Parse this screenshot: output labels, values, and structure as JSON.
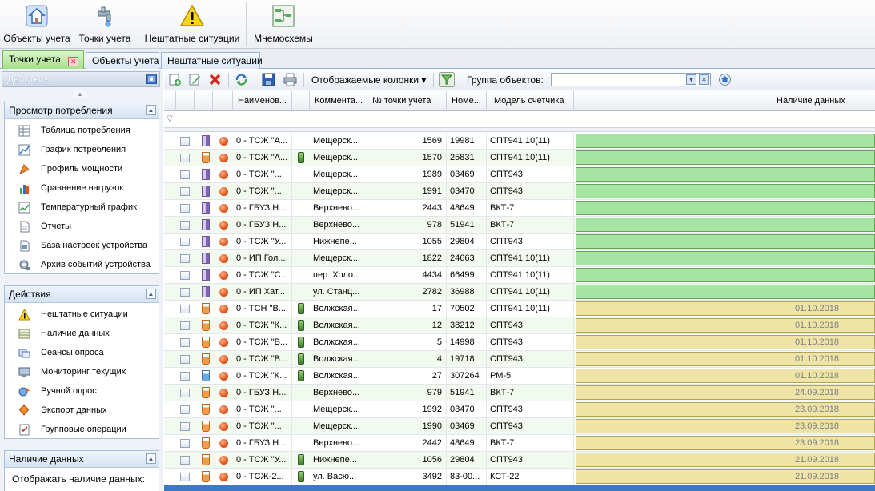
{
  "ribbon": {
    "buttons": [
      {
        "label": "Объекты учета",
        "icon": "house-icon"
      },
      {
        "label": "Точки учета",
        "icon": "faucet-icon"
      },
      {
        "label": "Нештатные ситуации",
        "icon": "warning-icon"
      },
      {
        "label": "Мнемосхемы",
        "icon": "diagram-icon"
      }
    ]
  },
  "tabs": [
    {
      "label": "Точки учета",
      "active": true
    },
    {
      "label": "Объекты учета",
      "active": false
    },
    {
      "label": "Нештатные ситуации",
      "active": false
    }
  ],
  "left_panel": {
    "title": "Действия",
    "groups": [
      {
        "title": "Просмотр потребления",
        "items": [
          "Таблица потребления",
          "График потребления",
          "Профиль мощности",
          "Сравнение нагрузок",
          "Температурный график",
          "Отчеты",
          "База настроек устройства",
          "Архив событий устройства"
        ]
      },
      {
        "title": "Действия",
        "items": [
          "Нештатные ситуации",
          "Наличие данных",
          "Сеансы опроса",
          "Мониторинг текущих",
          "Ручной опрос",
          "Экспорт данных",
          "Групповые операции"
        ]
      },
      {
        "title": "Наличие данных",
        "items": [
          "Отображать наличие данных:"
        ]
      }
    ]
  },
  "toolbar": {
    "columns_label": "Отображаемые колонки",
    "group_label": "Группа объектов:",
    "group_value": ""
  },
  "grid": {
    "columns": [
      "Наименов...",
      "Коммента...",
      "№ точки учета",
      "Номе...",
      "Модель счетчика",
      "Наличие данных"
    ],
    "rows": [
      {
        "meter": "heat",
        "device": false,
        "name": "0 - ТСЖ \"А...",
        "comment": "Мещерск...",
        "point": "1569",
        "num": "19981",
        "model": "СПТ941.10(11)",
        "avail": "green",
        "date": ""
      },
      {
        "meter": "water",
        "device": true,
        "name": "0 - ТСЖ \"А...",
        "comment": "Мещерск...",
        "point": "1570",
        "num": "25831",
        "model": "СПТ941.10(11)",
        "avail": "green",
        "date": ""
      },
      {
        "meter": "heat",
        "device": false,
        "name": "0 - ТСЖ \"...",
        "comment": "Мещерск...",
        "point": "1989",
        "num": "03469",
        "model": "СПТ943",
        "avail": "green",
        "date": ""
      },
      {
        "meter": "heat",
        "device": false,
        "name": "0 - ТСЖ \"...",
        "comment": "Мещерск...",
        "point": "1991",
        "num": "03470",
        "model": "СПТ943",
        "avail": "green",
        "date": ""
      },
      {
        "meter": "heat",
        "device": false,
        "name": "0 - ГБУЗ Н...",
        "comment": "Верхнево...",
        "point": "2443",
        "num": "48649",
        "model": "ВКТ-7",
        "avail": "green",
        "date": ""
      },
      {
        "meter": "heat",
        "device": false,
        "name": "0 - ГБУЗ Н...",
        "comment": "Верхнево...",
        "point": "978",
        "num": "51941",
        "model": "ВКТ-7",
        "avail": "green",
        "date": ""
      },
      {
        "meter": "heat",
        "device": false,
        "name": "0 - ТСЖ \"У...",
        "comment": "Нижнепе...",
        "point": "1055",
        "num": "29804",
        "model": "СПТ943",
        "avail": "green",
        "date": ""
      },
      {
        "meter": "heat",
        "device": false,
        "name": "0 - ИП Гол...",
        "comment": "Мещерск...",
        "point": "1822",
        "num": "24663",
        "model": "СПТ941.10(11)",
        "avail": "green",
        "date": ""
      },
      {
        "meter": "heat",
        "device": false,
        "name": "0 - ТСЖ \"С...",
        "comment": "пер. Холо...",
        "point": "4434",
        "num": "66499",
        "model": "СПТ941.10(11)",
        "avail": "green",
        "date": ""
      },
      {
        "meter": "heat",
        "device": false,
        "name": "0 - ИП Хат...",
        "comment": "ул. Станц...",
        "point": "2782",
        "num": "36988",
        "model": "СПТ941.10(11)",
        "avail": "green",
        "date": ""
      },
      {
        "meter": "water",
        "device": true,
        "name": "0 - ТСН \"В...",
        "comment": "Волжская...",
        "point": "17",
        "num": "70502",
        "model": "СПТ941.10(11)",
        "avail": "yellow",
        "date": "01.10.2018"
      },
      {
        "meter": "water",
        "device": true,
        "name": "0 - ТСЖ \"К...",
        "comment": "Волжская...",
        "point": "12",
        "num": "38212",
        "model": "СПТ943",
        "avail": "yellow",
        "date": "01.10.2018"
      },
      {
        "meter": "water",
        "device": true,
        "name": "0 - ТСЖ \"В...",
        "comment": "Волжская...",
        "point": "5",
        "num": "14998",
        "model": "СПТ943",
        "avail": "yellow",
        "date": "01.10.2018"
      },
      {
        "meter": "water",
        "device": true,
        "name": "0 - ТСЖ \"В...",
        "comment": "Волжская...",
        "point": "4",
        "num": "19718",
        "model": "СПТ943",
        "avail": "yellow",
        "date": "01.10.2018"
      },
      {
        "meter": "cold",
        "device": true,
        "name": "0 - ТСЖ \"К...",
        "comment": "Волжская...",
        "point": "27",
        "num": "307264",
        "model": "РМ-5",
        "avail": "yellow",
        "date": "01.10.2018"
      },
      {
        "meter": "water",
        "device": false,
        "name": "0 - ГБУЗ Н...",
        "comment": "Верхнево...",
        "point": "979",
        "num": "51941",
        "model": "ВКТ-7",
        "avail": "yellow",
        "date": "24.09.2018"
      },
      {
        "meter": "water",
        "device": false,
        "name": "0 - ТСЖ \"...",
        "comment": "Мещерск...",
        "point": "1992",
        "num": "03470",
        "model": "СПТ943",
        "avail": "yellow",
        "date": "23.09.2018"
      },
      {
        "meter": "water",
        "device": false,
        "name": "0 - ТСЖ \"...",
        "comment": "Мещерск...",
        "point": "1990",
        "num": "03469",
        "model": "СПТ943",
        "avail": "yellow",
        "date": "23.09.2018"
      },
      {
        "meter": "water",
        "device": false,
        "name": "0 - ГБУЗ Н...",
        "comment": "Верхнево...",
        "point": "2442",
        "num": "48649",
        "model": "ВКТ-7",
        "avail": "yellow",
        "date": "23.09.2018"
      },
      {
        "meter": "water",
        "device": true,
        "name": "0 - ТСЖ \"У...",
        "comment": "Нижнепе...",
        "point": "1056",
        "num": "29804",
        "model": "СПТ943",
        "avail": "yellow",
        "date": "21.09.2018"
      },
      {
        "meter": "water",
        "device": true,
        "name": "0 - ТСЖ-2...",
        "comment": "ул. Васю...",
        "point": "3492",
        "num": "83-00...",
        "model": "КСТ-22",
        "avail": "yellow",
        "date": "21.09.2018"
      }
    ]
  },
  "colors": {
    "avail_green": "#a5e5a1",
    "avail_yellow": "#efe4a5",
    "active_tab": "#a6e08a"
  }
}
